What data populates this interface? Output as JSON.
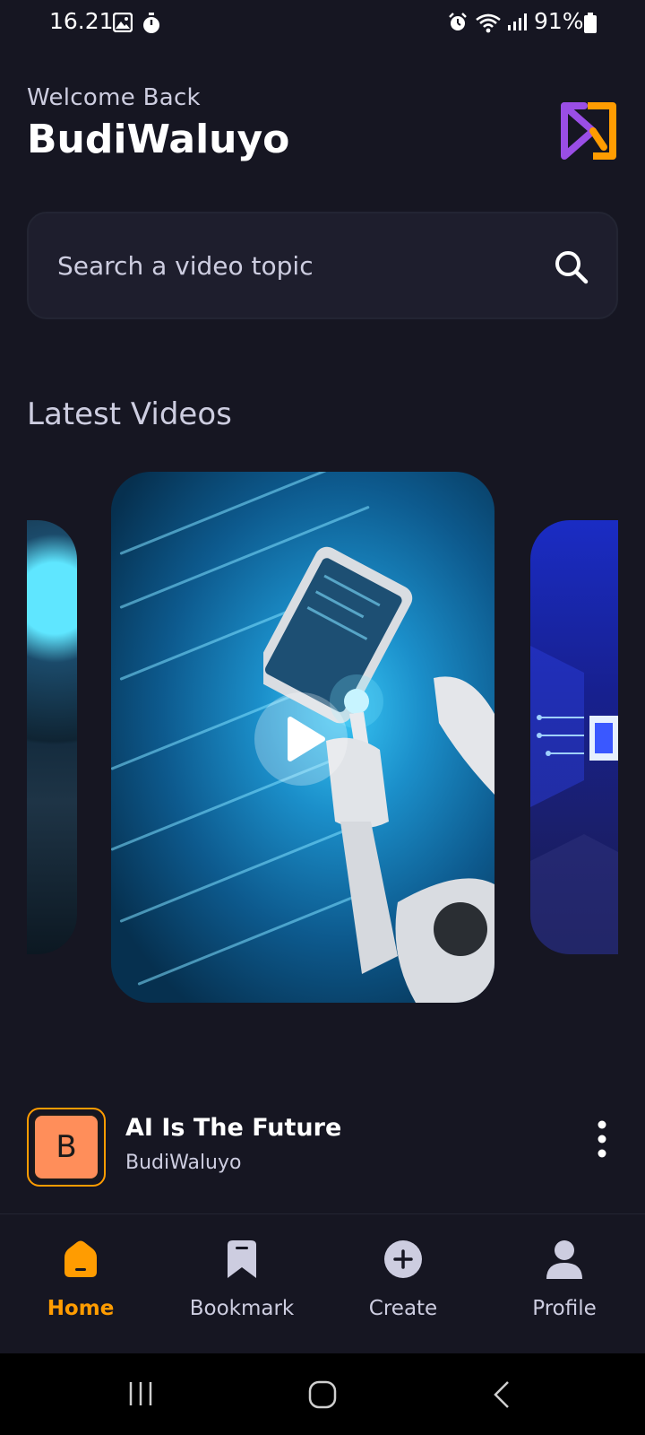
{
  "status_bar": {
    "time": "16.21",
    "battery": "91%",
    "icons": [
      "image-icon",
      "timer-icon",
      "alarm-icon",
      "wifi-icon",
      "signal-icon",
      "battery-icon"
    ]
  },
  "header": {
    "welcome": "Welcome Back",
    "username": "BudiWaluyo",
    "logo_colors": [
      "#9a4ee6",
      "#ff9c01"
    ]
  },
  "search": {
    "placeholder": "Search a video topic"
  },
  "latest": {
    "title": "Latest Videos"
  },
  "video": {
    "avatar_letter": "B",
    "title": "AI Is The Future",
    "author": "BudiWaluyo"
  },
  "tabs": [
    {
      "label": "Home",
      "icon": "home-icon",
      "active": true
    },
    {
      "label": "Bookmark",
      "icon": "bookmark-icon",
      "active": false
    },
    {
      "label": "Create",
      "icon": "plus-circle-icon",
      "active": false
    },
    {
      "label": "Profile",
      "icon": "user-icon",
      "active": false
    }
  ],
  "colors": {
    "background": "#161622",
    "accent": "#ff9c01",
    "muted_text": "#cdcde0",
    "search_bg": "#1e1e2d"
  }
}
